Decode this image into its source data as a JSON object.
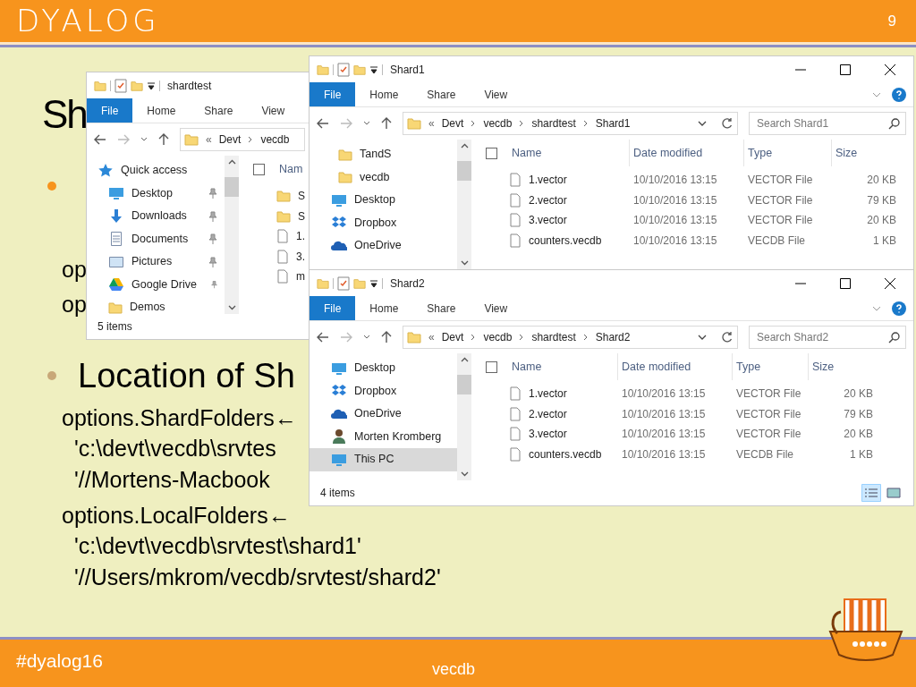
{
  "header": {
    "logo": "DYALOG",
    "page": "9"
  },
  "slide": {
    "title": "Sh",
    "lines": [
      {
        "kind": "bullet",
        "color": "#f7941d"
      },
      {
        "kind": "code",
        "text": "op"
      },
      {
        "kind": "code",
        "text": "op"
      },
      {
        "kind": "bullet",
        "color": "#c8a878",
        "text": "Location of Sh"
      },
      {
        "kind": "code",
        "text": "options.ShardFolders←"
      },
      {
        "kind": "code-indent",
        "text": "'c:\\devt\\vecdb\\srvtes"
      },
      {
        "kind": "code-indent",
        "text": "'//Mortens-Macbook"
      },
      {
        "kind": "code",
        "text": "options.LocalFolders←"
      },
      {
        "kind": "code-indent",
        "text": "'c:\\devt\\vecdb\\srvtest\\shard1'"
      },
      {
        "kind": "code-indent",
        "text": "'//Users/mkrom/vecdb/srvtest/shard2'"
      }
    ]
  },
  "windows": [
    {
      "title": "shardtest",
      "ribbon_tabs": [
        {
          "label": "File",
          "kind": "file"
        },
        {
          "label": "Home",
          "kind": "tab"
        },
        {
          "label": "Share",
          "kind": "tab"
        },
        {
          "label": "View",
          "kind": "tab"
        }
      ],
      "path": [
        "«",
        "Devt",
        "vecdb"
      ],
      "nav": [
        {
          "label": "Quick access",
          "selected": false
        },
        {
          "label": "Desktop",
          "selected": false
        },
        {
          "label": "Downloads",
          "selected": false
        },
        {
          "label": "Documents",
          "selected": false
        },
        {
          "label": "Pictures",
          "selected": false
        },
        {
          "label": "Google Drive",
          "selected": false
        },
        {
          "label": "Demos",
          "selected": false
        }
      ],
      "select_all_checked": false,
      "columns": [
        "Nam"
      ],
      "rows": [
        {
          "kind": "folder",
          "cells": [
            "S"
          ]
        },
        {
          "kind": "folder",
          "cells": [
            "S"
          ]
        },
        {
          "kind": "file",
          "cells": [
            "1."
          ]
        },
        {
          "kind": "file",
          "cells": [
            "3."
          ]
        },
        {
          "kind": "file",
          "cells": [
            "m"
          ]
        }
      ],
      "status": "5 items"
    },
    {
      "title": "Shard1",
      "ribbon_tabs": [
        {
          "label": "File",
          "kind": "file"
        },
        {
          "label": "Home",
          "kind": "tab"
        },
        {
          "label": "Share",
          "kind": "tab"
        },
        {
          "label": "View",
          "kind": "tab"
        }
      ],
      "path": [
        "«",
        "Devt",
        "vecdb",
        "shardtest",
        "Shard1"
      ],
      "search": {
        "placeholder": "Search Shard1"
      },
      "nav": [
        {
          "label": "TandS",
          "selected": false
        },
        {
          "label": "vecdb",
          "selected": false
        },
        {
          "label": "Desktop",
          "selected": false
        },
        {
          "label": "Dropbox",
          "selected": false
        },
        {
          "label": "OneDrive",
          "selected": false
        }
      ],
      "select_all_checked": false,
      "columns": [
        "Name",
        "Date modified",
        "Type",
        "Size"
      ],
      "rows": [
        {
          "kind": "file",
          "cells": [
            "1.vector",
            "10/10/2016 13:15",
            "VECTOR File",
            "20 KB"
          ]
        },
        {
          "kind": "file",
          "cells": [
            "2.vector",
            "10/10/2016 13:15",
            "VECTOR File",
            "79 KB"
          ]
        },
        {
          "kind": "file",
          "cells": [
            "3.vector",
            "10/10/2016 13:15",
            "VECTOR File",
            "20 KB"
          ]
        },
        {
          "kind": "file",
          "cells": [
            "counters.vecdb",
            "10/10/2016 13:15",
            "VECDB File",
            "1 KB"
          ]
        }
      ]
    },
    {
      "title": "Shard2",
      "ribbon_tabs": [
        {
          "label": "File",
          "kind": "file"
        },
        {
          "label": "Home",
          "kind": "tab"
        },
        {
          "label": "Share",
          "kind": "tab"
        },
        {
          "label": "View",
          "kind": "tab"
        }
      ],
      "path": [
        "«",
        "Devt",
        "vecdb",
        "shardtest",
        "Shard2"
      ],
      "search": {
        "placeholder": "Search Shard2"
      },
      "nav": [
        {
          "label": "Desktop",
          "selected": false
        },
        {
          "label": "Dropbox",
          "selected": false
        },
        {
          "label": "OneDrive",
          "selected": false
        },
        {
          "label": "Morten Kromberg",
          "selected": false
        },
        {
          "label": "This PC",
          "selected": true
        }
      ],
      "select_all_checked": false,
      "columns": [
        "Name",
        "Date modified",
        "Type",
        "Size"
      ],
      "rows": [
        {
          "kind": "file",
          "cells": [
            "1.vector",
            "10/10/2016 13:15",
            "VECTOR File",
            "20 KB"
          ]
        },
        {
          "kind": "file",
          "cells": [
            "2.vector",
            "10/10/2016 13:15",
            "VECTOR File",
            "79 KB"
          ]
        },
        {
          "kind": "file",
          "cells": [
            "3.vector",
            "10/10/2016 13:15",
            "VECTOR File",
            "20 KB"
          ]
        },
        {
          "kind": "file",
          "cells": [
            "counters.vecdb",
            "10/10/2016 13:15",
            "VECDB File",
            "1 KB"
          ]
        }
      ],
      "status": "4 items"
    }
  ],
  "footer": {
    "hashtag": "#dyalog16",
    "title": "vecdb"
  }
}
